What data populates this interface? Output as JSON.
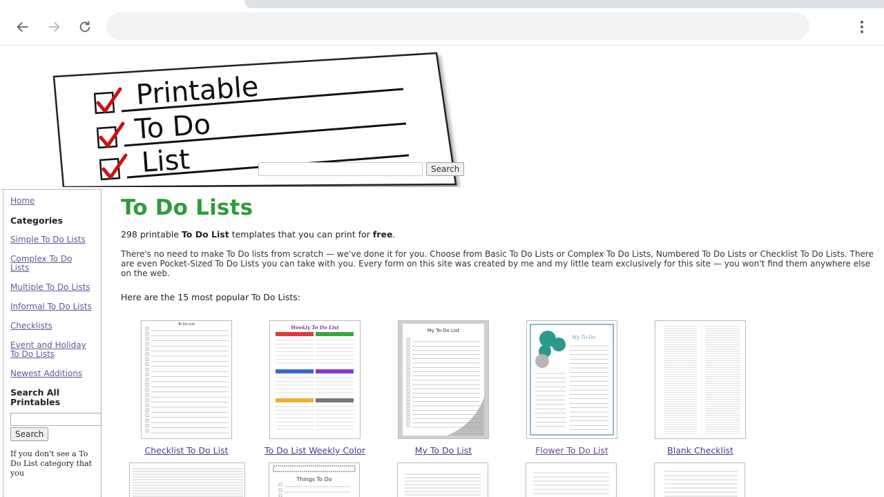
{
  "browser": {
    "back_label": "Back",
    "forward_label": "Forward",
    "reload_label": "Reload",
    "url": ""
  },
  "logo": {
    "line1": "Printable",
    "line2": "To Do",
    "line3": "List",
    "check_color": "#cc1111"
  },
  "header_search": {
    "placeholder": "",
    "button": "Search"
  },
  "sidebar": {
    "home": "Home",
    "categories_heading": "Categories",
    "links": [
      "Simple To Do Lists",
      "Complex To Do Lists",
      "Multiple To Do Lists",
      "Informal To Do Lists",
      "Checklists",
      "Event and Holiday To Do Lists",
      "Newest Additions"
    ],
    "search_heading": "Search All Printables",
    "search_button": "Search",
    "note": "If you don't see a To Do List category that you"
  },
  "main": {
    "title": "To Do Lists",
    "intro_count": "298",
    "intro_mid": " printable ",
    "intro_bold": "To Do List",
    "intro_rest": " templates that you can print for ",
    "intro_free": "free",
    "intro_end": ".",
    "description": "There's no need to make To Do lists from scratch — we've done it for you. Choose from Basic To Do Lists or Complex To Do Lists, Numbered To Do Lists or Checklist To Do Lists. There are even Pocket-Sized To Do Lists you can take with you. Every form on this site was created by me and my little team exclusively for this site — you won't find them anywhere else on the web.",
    "popular_heading": "Here are the 15 most popular To Do Lists:"
  },
  "popular": [
    {
      "label": "Checklist To Do List",
      "thumb_title": "To Do List"
    },
    {
      "label": "To Do List Weekly Color",
      "thumb_title": "Weekly To Do List"
    },
    {
      "label": "My To Do List",
      "thumb_title": "My To-Do List"
    },
    {
      "label": "Flower To Do List",
      "thumb_title": "My To-Do"
    },
    {
      "label": "Blank Checklist",
      "thumb_title": ""
    }
  ],
  "second_row": [
    {
      "thumb_title": ""
    },
    {
      "thumb_title": "Things To Do"
    },
    {
      "thumb_title": ""
    },
    {
      "thumb_title": ""
    },
    {
      "thumb_title": ""
    }
  ],
  "colors": {
    "title_green": "#2e9c3a",
    "link": "#3f3f8f",
    "sidebar_link": "#5b5b9a"
  }
}
